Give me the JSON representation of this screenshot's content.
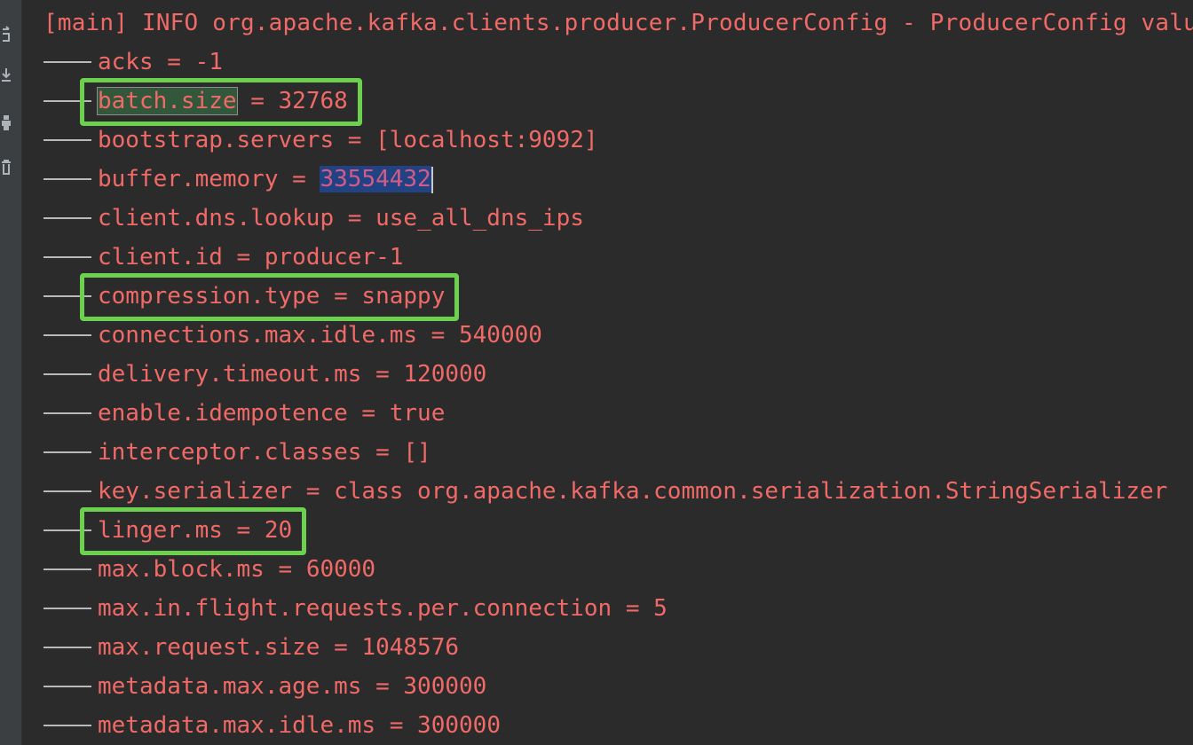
{
  "header_line": "[main] INFO org.apache.kafka.clients.producer.ProducerConfig - ProducerConfig value",
  "rows": [
    {
      "key": "acks",
      "value": "-1"
    },
    {
      "key": "batch.size",
      "value": "32768"
    },
    {
      "key": "bootstrap.servers",
      "value": "[localhost:9092]"
    },
    {
      "key": "buffer.memory",
      "value": "33554432"
    },
    {
      "key": "client.dns.lookup",
      "value": "use_all_dns_ips"
    },
    {
      "key": "client.id",
      "value": "producer-1"
    },
    {
      "key": "compression.type",
      "value": "snappy"
    },
    {
      "key": "connections.max.idle.ms",
      "value": "540000"
    },
    {
      "key": "delivery.timeout.ms",
      "value": "120000"
    },
    {
      "key": "enable.idempotence",
      "value": "true"
    },
    {
      "key": "interceptor.classes",
      "value": "[]"
    },
    {
      "key": "key.serializer",
      "value": "class org.apache.kafka.common.serialization.StringSerializer"
    },
    {
      "key": "linger.ms",
      "value": "20"
    },
    {
      "key": "max.block.ms",
      "value": "60000"
    },
    {
      "key": "max.in.flight.requests.per.connection",
      "value": "5"
    },
    {
      "key": "max.request.size",
      "value": "1048576"
    },
    {
      "key": "metadata.max.age.ms",
      "value": "300000"
    },
    {
      "key": "metadata.max.idle.ms",
      "value": "300000"
    }
  ],
  "separator": " = ",
  "highlighted_keys": [
    "batch.size",
    "compression.type",
    "linger.ms"
  ],
  "selected_value": "33554432",
  "colors": {
    "log_text": "#f06a67",
    "background": "#2b2b2b",
    "highlight_box": "#6cd14e",
    "selection": "#214283",
    "match_highlight": "#33573a"
  },
  "gutter_icons": [
    "rerun-icon",
    "scroll-to-end-icon",
    "print-icon",
    "trash-icon"
  ]
}
